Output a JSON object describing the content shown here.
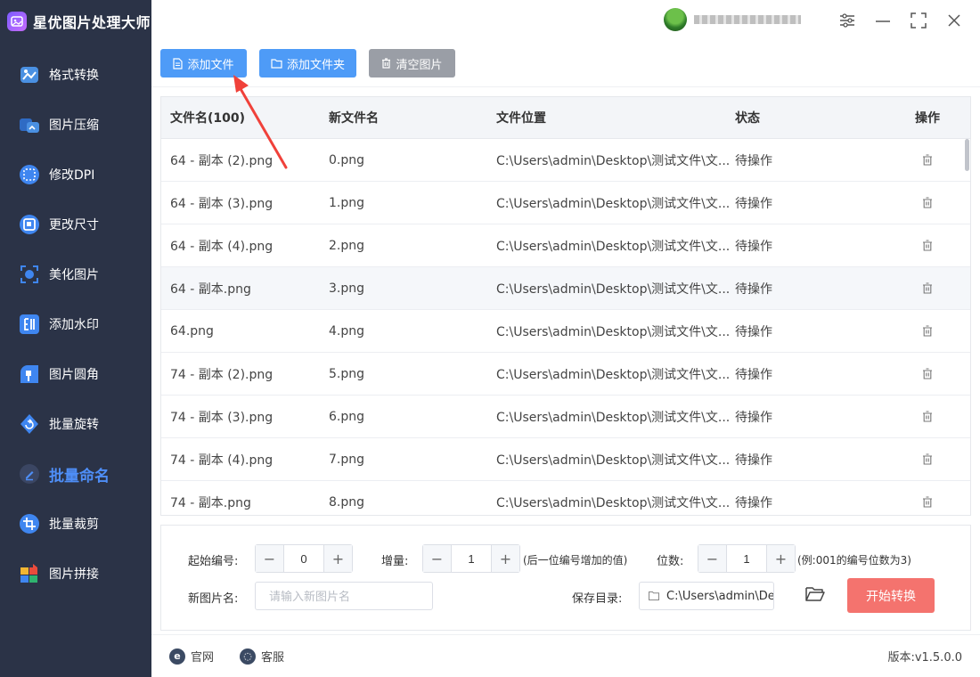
{
  "app": {
    "name": "星优图片处理大师"
  },
  "sidebar": {
    "items": [
      {
        "label": "格式转换",
        "icon": "format-convert-icon",
        "color": "#4a90e2"
      },
      {
        "label": "图片压缩",
        "icon": "compress-icon",
        "color": "#3a7bd5"
      },
      {
        "label": "修改DPI",
        "icon": "dpi-icon",
        "color": "#3f86f0"
      },
      {
        "label": "更改尺寸",
        "icon": "resize-icon",
        "color": "#3f86f0"
      },
      {
        "label": "美化图片",
        "icon": "beautify-icon",
        "color": "#3f86f0"
      },
      {
        "label": "添加水印",
        "icon": "watermark-icon",
        "color": "#3f86f0"
      },
      {
        "label": "图片圆角",
        "icon": "round-corner-icon",
        "color": "#3f86f0"
      },
      {
        "label": "批量旋转",
        "icon": "rotate-icon",
        "color": "#3f86f0"
      },
      {
        "label": "批量命名",
        "icon": "rename-icon",
        "color": "#4e8ef7",
        "active": true
      },
      {
        "label": "批量裁剪",
        "icon": "crop-icon",
        "color": "#3f86f0"
      },
      {
        "label": "图片拼接",
        "icon": "stitch-icon",
        "color": "#e94b3c"
      }
    ]
  },
  "toolbar": {
    "add_file": "添加文件",
    "add_folder": "添加文件夹",
    "clear": "清空图片"
  },
  "table": {
    "headers": {
      "file_name": "文件名(100)",
      "new_name": "新文件名",
      "location": "文件位置",
      "status": "状态",
      "action": "操作"
    },
    "rows": [
      {
        "file": "64 - 副本 (2).png",
        "new": "0.png",
        "path": "C:\\Users\\admin\\Desktop\\测试文件\\文...",
        "status": "待操作"
      },
      {
        "file": "64 - 副本 (3).png",
        "new": "1.png",
        "path": "C:\\Users\\admin\\Desktop\\测试文件\\文...",
        "status": "待操作"
      },
      {
        "file": "64 - 副本 (4).png",
        "new": "2.png",
        "path": "C:\\Users\\admin\\Desktop\\测试文件\\文...",
        "status": "待操作"
      },
      {
        "file": "64 - 副本.png",
        "new": "3.png",
        "path": "C:\\Users\\admin\\Desktop\\测试文件\\文...",
        "status": "待操作"
      },
      {
        "file": "64.png",
        "new": "4.png",
        "path": "C:\\Users\\admin\\Desktop\\测试文件\\文...",
        "status": "待操作"
      },
      {
        "file": "74 - 副本 (2).png",
        "new": "5.png",
        "path": "C:\\Users\\admin\\Desktop\\测试文件\\文...",
        "status": "待操作"
      },
      {
        "file": "74 - 副本 (3).png",
        "new": "6.png",
        "path": "C:\\Users\\admin\\Desktop\\测试文件\\文...",
        "status": "待操作"
      },
      {
        "file": "74 - 副本 (4).png",
        "new": "7.png",
        "path": "C:\\Users\\admin\\Desktop\\测试文件\\文...",
        "status": "待操作"
      },
      {
        "file": "74 - 副本.png",
        "new": "8.png",
        "path": "C:\\Users\\admin\\Desktop\\测试文件\\文...",
        "status": "待操作"
      }
    ]
  },
  "settings": {
    "start_number_label": "起始编号:",
    "start_number_value": "0",
    "increment_label": "增量:",
    "increment_value": "1",
    "increment_hint": "(后一位编号增加的值)",
    "digits_label": "位数:",
    "digits_value": "1",
    "digits_hint": "(例:001的编号位数为3)",
    "new_name_label": "新图片名:",
    "new_name_placeholder": "请输入新图片名",
    "save_dir_label": "保存目录:",
    "save_dir_value": "C:\\Users\\admin\\Deskto",
    "start_button": "开始转换"
  },
  "footer": {
    "website": "官网",
    "support": "客服",
    "version": "版本:v1.5.0.0"
  },
  "colors": {
    "sidebar_bg": "#2b3347",
    "accent": "#4e9bf7",
    "start_button": "#f4736e",
    "arrow": "#f0413a"
  }
}
